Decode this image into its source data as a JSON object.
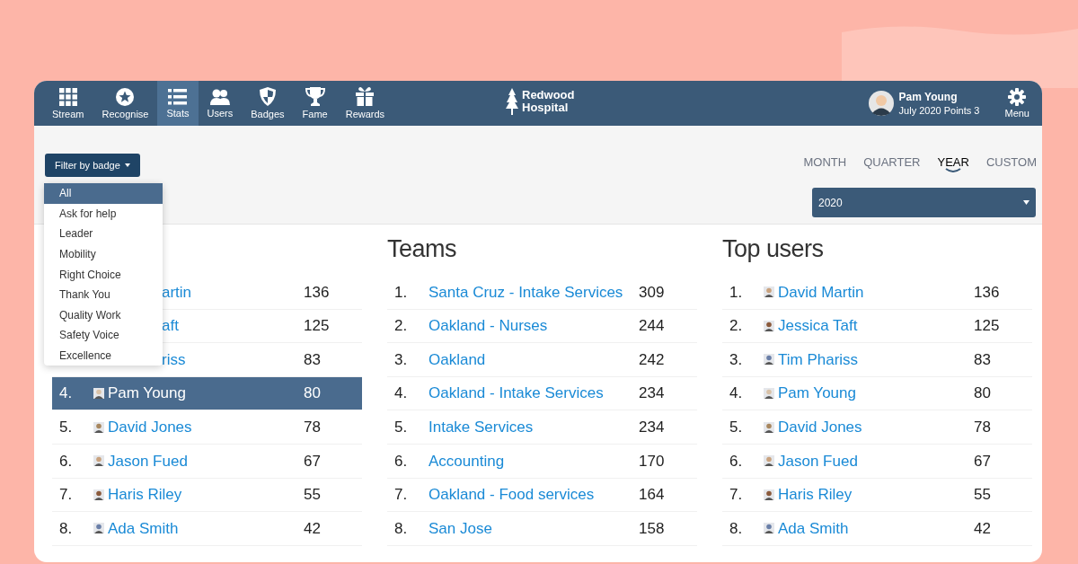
{
  "nav": {
    "items": [
      {
        "label": "Stream",
        "kind": "grid",
        "selected": false
      },
      {
        "label": "Recognise",
        "kind": "star",
        "selected": false
      },
      {
        "label": "Stats",
        "kind": "list",
        "selected": true
      },
      {
        "label": "Users",
        "kind": "users",
        "selected": false
      },
      {
        "label": "Badges",
        "kind": "shield",
        "selected": false
      },
      {
        "label": "Fame",
        "kind": "trophy",
        "selected": false
      },
      {
        "label": "Rewards",
        "kind": "gift",
        "selected": false
      }
    ]
  },
  "logo": {
    "text": "Redwood Hospital"
  },
  "user": {
    "name": "Pam Young",
    "subtitle": "July 2020 Points 3"
  },
  "menu": {
    "label": "Menu"
  },
  "filter": {
    "label": "Filter by badge",
    "options": [
      {
        "label": "All",
        "selected": true
      },
      {
        "label": "Ask for help",
        "selected": false
      },
      {
        "label": "Leader",
        "selected": false
      },
      {
        "label": "Mobility",
        "selected": false
      },
      {
        "label": "Right Choice",
        "selected": false
      },
      {
        "label": "Thank You",
        "selected": false
      },
      {
        "label": "Quality Work",
        "selected": false
      },
      {
        "label": "Safety Voice",
        "selected": false
      },
      {
        "label": "Excellence",
        "selected": false
      }
    ]
  },
  "periods": [
    {
      "label": "MONTH",
      "selected": false
    },
    {
      "label": "QUARTER",
      "selected": false
    },
    {
      "label": "YEAR",
      "selected": true
    },
    {
      "label": "CUSTOM",
      "selected": false
    }
  ],
  "year_select": {
    "value": "2020"
  },
  "panels": [
    {
      "rows": [
        {
          "kind": "partial",
          "name": "artin",
          "score": "136",
          "selected": false
        },
        {
          "kind": "partial",
          "name": "aft",
          "score": "125",
          "selected": false
        },
        {
          "kind": "partial",
          "name": "riss",
          "score": "83",
          "selected": false
        },
        {
          "kind": "full",
          "rank": "4.",
          "name": "Pam Young",
          "score": "80",
          "avatar": true,
          "selected": true
        },
        {
          "kind": "full",
          "rank": "5.",
          "name": "David Jones",
          "score": "78",
          "avatar": true,
          "selected": false
        },
        {
          "kind": "full",
          "rank": "6.",
          "name": "Jason Fued",
          "score": "67",
          "avatar": true,
          "selected": false
        },
        {
          "kind": "full",
          "rank": "7.",
          "name": "Haris Riley",
          "score": "55",
          "avatar": true,
          "selected": false
        },
        {
          "kind": "full",
          "rank": "8.",
          "name": "Ada Smith",
          "score": "42",
          "avatar": true,
          "selected": false
        }
      ]
    },
    {
      "title": "Teams",
      "rows": [
        {
          "kind": "full",
          "rank": "1.",
          "name": "Santa Cruz - Intake Services",
          "score": "309",
          "selected": false
        },
        {
          "kind": "full",
          "rank": "2.",
          "name": "Oakland - Nurses",
          "score": "244",
          "selected": false
        },
        {
          "kind": "full",
          "rank": "3.",
          "name": "Oakland",
          "score": "242",
          "selected": false
        },
        {
          "kind": "full",
          "rank": "4.",
          "name": "Oakland - Intake Services",
          "score": "234",
          "selected": false
        },
        {
          "kind": "full",
          "rank": "5.",
          "name": "Intake Services",
          "score": "234",
          "selected": false
        },
        {
          "kind": "full",
          "rank": "6.",
          "name": "Accounting",
          "score": "170",
          "selected": false
        },
        {
          "kind": "full",
          "rank": "7.",
          "name": "Oakland - Food services",
          "score": "164",
          "selected": false
        },
        {
          "kind": "full",
          "rank": "8.",
          "name": "San Jose",
          "score": "158",
          "selected": false
        }
      ]
    },
    {
      "title": "Top users",
      "rows": [
        {
          "kind": "full",
          "rank": "1.",
          "name": "David Martin",
          "score": "136",
          "avatar": true,
          "selected": false
        },
        {
          "kind": "full",
          "rank": "2.",
          "name": "Jessica Taft",
          "score": "125",
          "avatar": true,
          "selected": false
        },
        {
          "kind": "full",
          "rank": "3.",
          "name": "Tim Phariss",
          "score": "83",
          "avatar": true,
          "selected": false
        },
        {
          "kind": "full",
          "rank": "4.",
          "name": "Pam Young",
          "score": "80",
          "avatar": true,
          "selected": false
        },
        {
          "kind": "full",
          "rank": "5.",
          "name": "David Jones",
          "score": "78",
          "avatar": true,
          "selected": false
        },
        {
          "kind": "full",
          "rank": "6.",
          "name": "Jason Fued",
          "score": "67",
          "avatar": true,
          "selected": false
        },
        {
          "kind": "full",
          "rank": "7.",
          "name": "Haris Riley",
          "score": "55",
          "avatar": true,
          "selected": false
        },
        {
          "kind": "full",
          "rank": "8.",
          "name": "Ada Smith",
          "score": "42",
          "avatar": true,
          "selected": false
        }
      ]
    }
  ]
}
